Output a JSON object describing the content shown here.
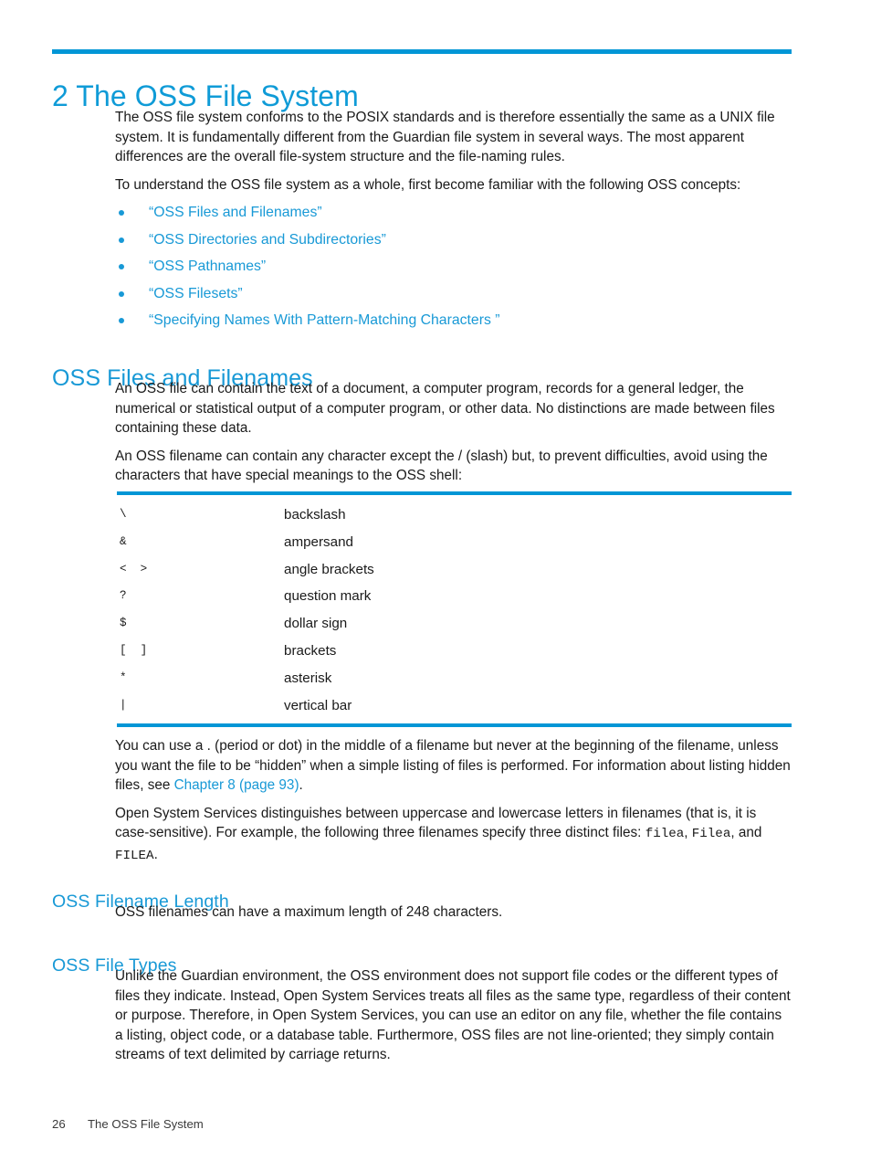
{
  "document": {
    "chapter_number": "2",
    "chapter_title": "2 The OSS File System",
    "accent_color": "#0096d6",
    "link_color": "#1899d6",
    "heading_color": "#1899d6",
    "body_color": "#1a1a1a"
  },
  "intro": {
    "paragraph_1": "The OSS file system conforms to the POSIX standards and is therefore essentially the same as a UNIX file system. It is fundamentally different from the Guardian file system in several ways. The most apparent differences are the overall file-system structure and the file-naming rules.",
    "paragraph_2": "To understand the OSS file system as a whole, first become familiar with the following OSS concepts:",
    "concept_links": [
      "“OSS Files and Filenames”",
      "“OSS Directories and Subdirectories”",
      "“OSS Pathnames”",
      "“OSS Filesets”",
      "“Specifying Names With Pattern-Matching Characters ”"
    ]
  },
  "section_files_and_filenames": {
    "heading": "OSS Files and Filenames",
    "paragraph_1": "An OSS file can contain the text of a document, a computer program, records for a general ledger, the numerical or statistical output of a computer program, or other data. No distinctions are made between files containing these data.",
    "paragraph_2": "An OSS filename can contain any character except the / (slash) but, to prevent difficulties, avoid using the characters that have special meanings to the OSS shell:",
    "special_characters": [
      {
        "symbol": "\\",
        "description": "backslash"
      },
      {
        "symbol": "&",
        "description": "ampersand"
      },
      {
        "symbol": "<  >",
        "description": "angle brackets"
      },
      {
        "symbol": "?",
        "description": "question mark"
      },
      {
        "symbol": "$",
        "description": "dollar sign"
      },
      {
        "symbol": "[  ]",
        "description": "brackets"
      },
      {
        "symbol": "*",
        "description": "asterisk"
      },
      {
        "symbol": "|",
        "description": "vertical bar"
      }
    ],
    "paragraph_3_before_link": "You can use a  . (period or dot) in the middle of a filename but never at the beginning of the filename, unless you want the file to be “hidden” when a simple listing of files is performed. For information about listing hidden files, see ",
    "paragraph_3_link": "Chapter 8 (page 93)",
    "paragraph_3_after_link": ".",
    "paragraph_4_part_1": "Open System Services distinguishes between uppercase and lowercase letters in filenames (that is, it is case-sensitive). For example, the following three filenames specify three distinct files: ",
    "paragraph_4_code_1": "filea",
    "paragraph_4_part_2": ", ",
    "paragraph_4_code_2": "Filea",
    "paragraph_4_part_3": ", and ",
    "paragraph_4_code_3": "FILEA",
    "paragraph_4_part_4": "."
  },
  "section_filename_length": {
    "heading": "OSS Filename Length",
    "paragraph_1": "OSS filenames can have a maximum length of 248 characters."
  },
  "section_file_types": {
    "heading": "OSS File Types",
    "paragraph_1": "Unlike the Guardian environment, the OSS environment does not support file codes or the different types of files they indicate. Instead, Open System Services treats all files as the same type, regardless of their content or purpose. Therefore, in Open System Services, you can use an editor on any file, whether the file contains a listing, object code, or a database table. Furthermore, OSS files are not line-oriented; they simply contain streams of text delimited by carriage returns."
  },
  "footer": {
    "page_number": "26",
    "running_title": "The OSS File System"
  }
}
